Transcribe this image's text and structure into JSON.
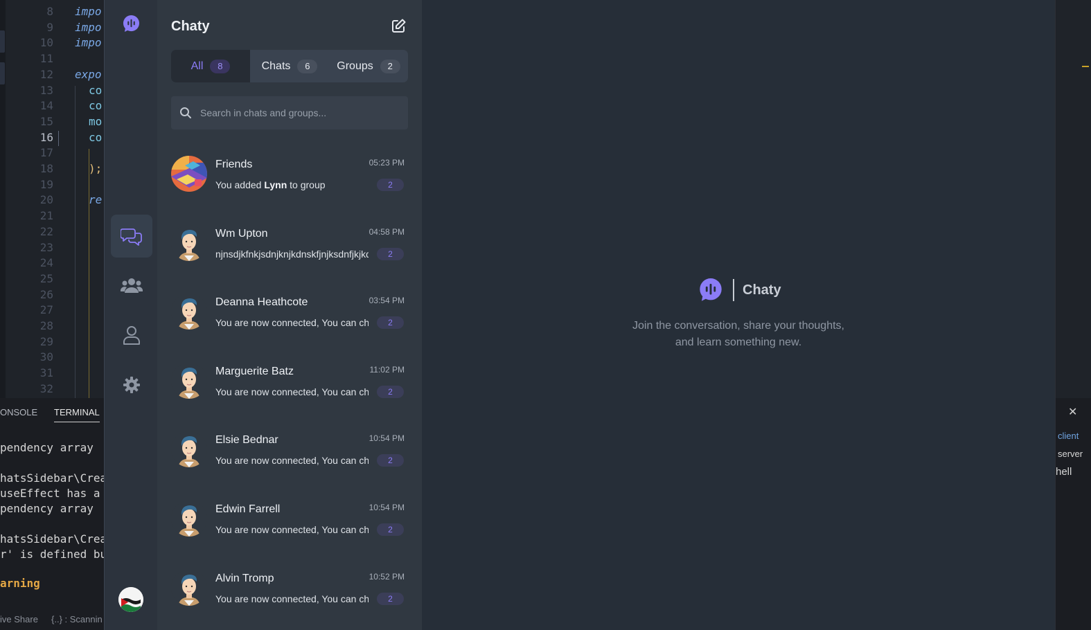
{
  "editor": {
    "lines": [
      {
        "num": "8",
        "text": "impo",
        "cls": "kw"
      },
      {
        "num": "9",
        "text": "impo",
        "cls": "kw"
      },
      {
        "num": "10",
        "text": "impo",
        "cls": "kw"
      },
      {
        "num": "11",
        "text": "",
        "cls": ""
      },
      {
        "num": "12",
        "text": "expo",
        "cls": "kw"
      },
      {
        "num": "13",
        "text": "co",
        "cls": "kw2"
      },
      {
        "num": "14",
        "text": "co",
        "cls": "kw2"
      },
      {
        "num": "15",
        "text": "mo",
        "cls": "kw2"
      },
      {
        "num": "16",
        "text": "co",
        "cls": "kw2"
      },
      {
        "num": "17",
        "text": "",
        "cls": ""
      },
      {
        "num": "18",
        "text": ");",
        "cls": "yel"
      },
      {
        "num": "19",
        "text": "",
        "cls": ""
      },
      {
        "num": "20",
        "text": "re",
        "cls": "kw"
      },
      {
        "num": "21",
        "text": "",
        "cls": ""
      },
      {
        "num": "22",
        "text": "",
        "cls": ""
      },
      {
        "num": "23",
        "text": "",
        "cls": ""
      },
      {
        "num": "24",
        "text": "",
        "cls": ""
      },
      {
        "num": "25",
        "text": "",
        "cls": ""
      },
      {
        "num": "26",
        "text": "",
        "cls": ""
      },
      {
        "num": "27",
        "text": "",
        "cls": ""
      },
      {
        "num": "28",
        "text": "",
        "cls": ""
      },
      {
        "num": "29",
        "text": "",
        "cls": ""
      },
      {
        "num": "30",
        "text": "",
        "cls": ""
      },
      {
        "num": "31",
        "text": "",
        "cls": ""
      },
      {
        "num": "32",
        "text": "",
        "cls": ""
      }
    ]
  },
  "terminal": {
    "tab_console": "ONSOLE",
    "tab_terminal": "TERMINAL",
    "lines": [
      "pendency array",
      "",
      "hatsSidebar\\Crea",
      "useEffect has a",
      "pendency array",
      "",
      "hatsSidebar\\Crea",
      "r' is defined bu",
      "",
      "arning"
    ],
    "status_share": "ive Share",
    "status_scan": "{..} : Scannin"
  },
  "right_panel": {
    "client": "client",
    "server": "server",
    "shell": "hell"
  },
  "app": {
    "title": "Chaty",
    "tabs": [
      {
        "label": "All",
        "count": "8"
      },
      {
        "label": "Chats",
        "count": "6"
      },
      {
        "label": "Groups",
        "count": "2"
      }
    ],
    "search_placeholder": "Search in chats and groups...",
    "chats": [
      {
        "name": "Friends",
        "time": "05:23 PM",
        "msg_pre": "You added ",
        "msg_bold": "Lynn",
        "msg_post": " to group",
        "badge": "2",
        "avatar": "group-avatar"
      },
      {
        "name": "Wm Upton",
        "time": "04:58 PM",
        "msg_pre": "njnsdjkfnkjsdnjknjkdnskfjnjksdnfjkjkdsf",
        "msg_bold": "",
        "msg_post": "",
        "badge": "2",
        "avatar": "user-avatar"
      },
      {
        "name": "Deanna Heathcote",
        "time": "03:54 PM",
        "msg_pre": "You are now connected, You can chat now",
        "msg_bold": "",
        "msg_post": "",
        "badge": "2",
        "avatar": "user-avatar"
      },
      {
        "name": "Marguerite Batz",
        "time": "11:02 PM",
        "msg_pre": "You are now connected, You can chat now",
        "msg_bold": "",
        "msg_post": "",
        "badge": "2",
        "avatar": "user-avatar"
      },
      {
        "name": "Elsie Bednar",
        "time": "10:54 PM",
        "msg_pre": "You are now connected, You can chat now",
        "msg_bold": "",
        "msg_post": "",
        "badge": "2",
        "avatar": "user-avatar"
      },
      {
        "name": "Edwin Farrell",
        "time": "10:54 PM",
        "msg_pre": "You are now connected, You can chat now",
        "msg_bold": "",
        "msg_post": "",
        "badge": "2",
        "avatar": "user-avatar"
      },
      {
        "name": "Alvin Tromp",
        "time": "10:52 PM",
        "msg_pre": "You are now connected, You can chat now",
        "msg_bold": "",
        "msg_post": "",
        "badge": "2",
        "avatar": "user-avatar"
      }
    ],
    "welcome": {
      "title": "Chaty",
      "line1": "Join the conversation, share your thoughts,",
      "line2": "and learn something new."
    }
  },
  "colors": {
    "accent": "#8b7cf6",
    "rail": "#2c333d",
    "sidebar": "#303841",
    "main": "#262e38"
  }
}
